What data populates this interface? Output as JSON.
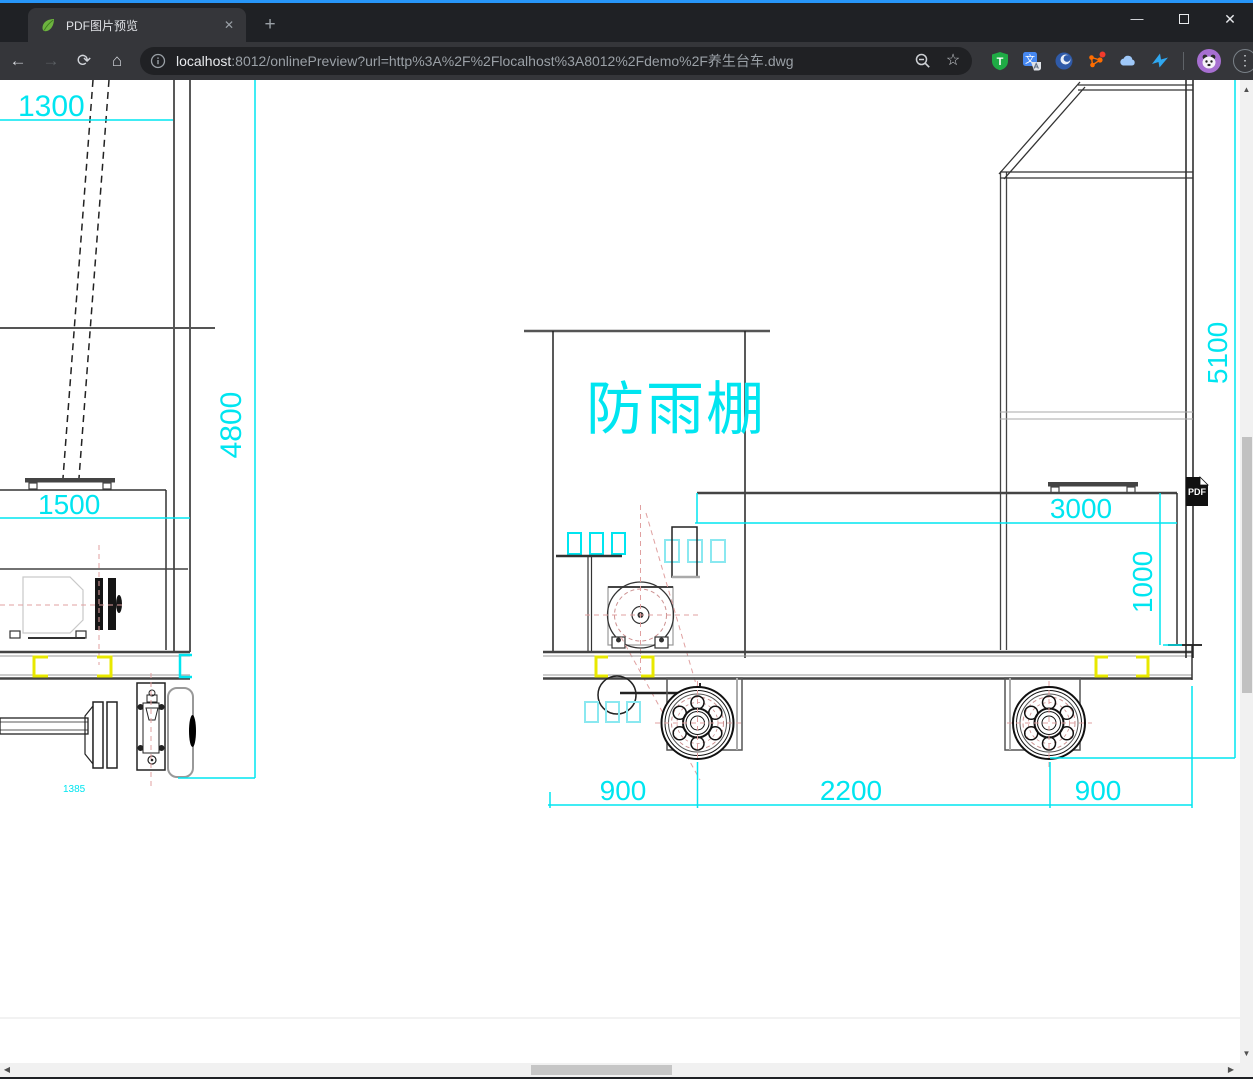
{
  "window": {
    "accent_color": "#2796f9",
    "controls": {
      "minimize": "—",
      "close": "✕"
    }
  },
  "tab": {
    "title": "PDF图片预览",
    "close_glyph": "✕"
  },
  "new_tab_glyph": "+",
  "toolbar": {
    "back_glyph": "←",
    "forward_glyph": "→",
    "reload_glyph": "⟳",
    "home_glyph": "⌂",
    "omnibox": {
      "host": "localhost",
      "rest": ":8012/onlinePreview?url=http%3A%2F%2Flocalhost%3A8012%2Fdemo%2F养生台车.dwg",
      "star_glyph": "☆"
    },
    "extensions": {
      "tampermonkey_letter": "T",
      "translate_glyph": "文"
    },
    "menu_glyph": "⋮"
  },
  "drawing": {
    "shelter_label": "防雨棚",
    "pdf_badge": "PDF",
    "dims": {
      "left_top": "1300",
      "left_height": "4800",
      "left_width": "1500",
      "axle_span": "1385",
      "right_height": "5100",
      "deck_span": "3000",
      "deck_height": "1000",
      "wheel_left": "900",
      "wheelbase": "2200",
      "wheel_right": "900"
    }
  },
  "scrollbars": {
    "up": "▲",
    "down": "▼",
    "left": "◀",
    "right": "▶"
  }
}
